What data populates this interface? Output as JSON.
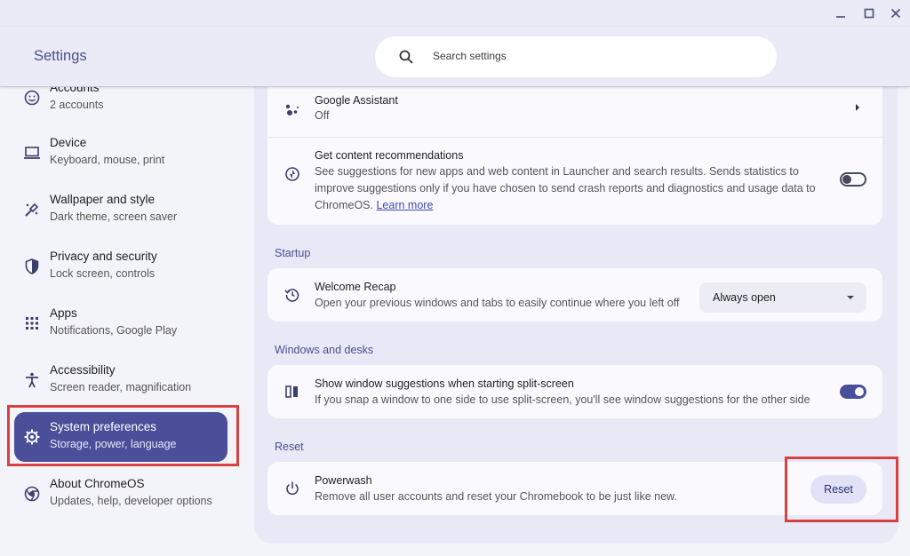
{
  "window": {
    "minimize": "–",
    "maximize": "☐",
    "close": "✕"
  },
  "header": {
    "title": "Settings",
    "search_placeholder": "Search settings"
  },
  "sidebar": {
    "items": [
      {
        "label": "Accounts",
        "sub": "2 accounts",
        "icon": "account-icon"
      },
      {
        "label": "Device",
        "sub": "Keyboard, mouse, print",
        "icon": "laptop-icon"
      },
      {
        "label": "Wallpaper and style",
        "sub": "Dark theme, screen saver",
        "icon": "paintbrush-icon"
      },
      {
        "label": "Privacy and security",
        "sub": "Lock screen, controls",
        "icon": "shield-icon"
      },
      {
        "label": "Apps",
        "sub": "Notifications, Google Play",
        "icon": "apps-grid-icon"
      },
      {
        "label": "Accessibility",
        "sub": "Screen reader, magnification",
        "icon": "accessibility-icon"
      },
      {
        "label": "System preferences",
        "sub": "Storage, power, language",
        "icon": "gear-icon",
        "active": true
      },
      {
        "label": "About ChromeOS",
        "sub": "Updates, help, developer options",
        "icon": "chrome-icon"
      }
    ]
  },
  "main": {
    "assistant": {
      "title": "Google Assistant",
      "sub": "Off"
    },
    "recommendations": {
      "title": "Get content recommendations",
      "line1": "See suggestions for new apps and web content in Launcher and search results. Sends statistics to",
      "line2": "improve suggestions only if you have chosen to send crash reports and diagnostics and usage data to",
      "line3": "ChromeOS.",
      "link": "Learn more",
      "toggle": "off"
    },
    "startup": {
      "section": "Startup",
      "title": "Welcome Recap",
      "sub": "Open your previous windows and tabs to easily continue where you left off",
      "dropdown": "Always open"
    },
    "windows": {
      "section": "Windows and desks",
      "title": "Show window suggestions when starting split-screen",
      "sub": "If you snap a window to one side to use split-screen, you'll see window suggestions for the other side",
      "toggle": "on"
    },
    "reset": {
      "section": "Reset",
      "title": "Powerwash",
      "sub": "Remove all user accounts and reset your Chromebook to be just like new.",
      "button": "Reset"
    }
  },
  "colors": {
    "accent": "#4b4f99",
    "highlight": "#d94141"
  }
}
